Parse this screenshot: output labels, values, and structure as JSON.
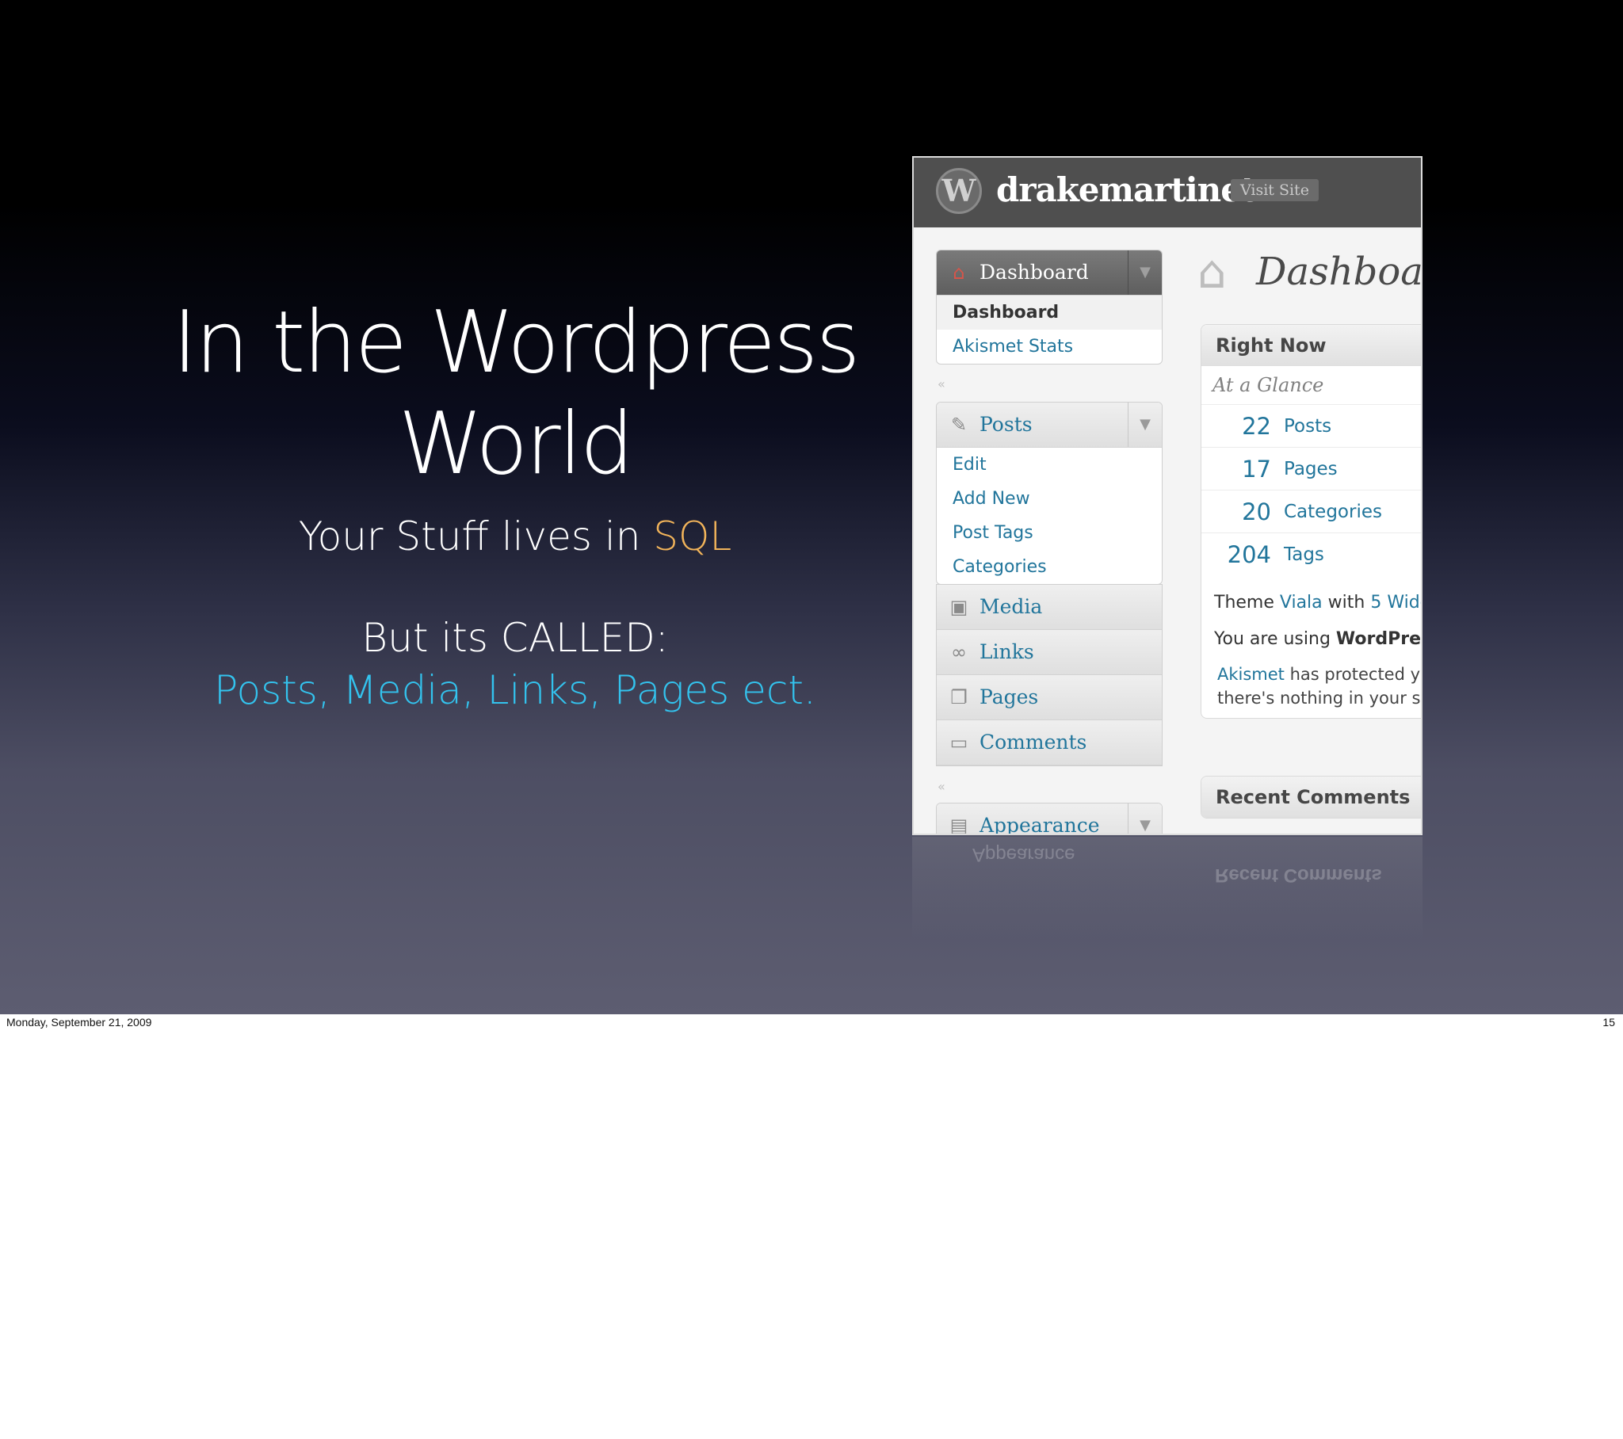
{
  "slide": {
    "title_line1": "In the Wordpress",
    "title_line2": "World",
    "subtitle_prefix": "Your Stuff lives in ",
    "subtitle_highlight": "SQL",
    "called_line": "But its CALLED:",
    "called_items": "Posts, Media, Links, Pages ect."
  },
  "screenshot": {
    "site_name": "drakemartinet",
    "visit_site": "Visit Site",
    "menu": {
      "dashboard": "Dashboard",
      "dashboard_sub": [
        "Dashboard",
        "Akismet Stats"
      ],
      "posts": "Posts",
      "posts_sub": [
        "Edit",
        "Add New",
        "Post Tags",
        "Categories"
      ],
      "media": "Media",
      "links": "Links",
      "pages": "Pages",
      "comments": "Comments",
      "appearance": "Appearance"
    },
    "page_title": "Dashboar",
    "right_now": {
      "heading": "Right Now",
      "at_a_glance": "At a Glance",
      "stats": [
        {
          "num": "22",
          "name": "Posts"
        },
        {
          "num": "17",
          "name": "Pages"
        },
        {
          "num": "20",
          "name": "Categories"
        },
        {
          "num": "204",
          "name": "Tags"
        }
      ],
      "theme_prefix": "Theme ",
      "theme_name": "Viala",
      "theme_with": " with ",
      "widgets": "5 Widg",
      "using_prefix": "You are using ",
      "using_name": "WordPres",
      "akismet": "Akismet",
      "akismet_text": " has protected y",
      "akismet_text2": "there's nothing in your s"
    },
    "recent_comments": "Recent Comments"
  },
  "footer": {
    "date": "Monday, September 21, 2009",
    "page": "15"
  },
  "colors": {
    "highlight_sql": "#f2b45a",
    "highlight_called": "#33c3ee",
    "wp_link": "#21759b"
  }
}
